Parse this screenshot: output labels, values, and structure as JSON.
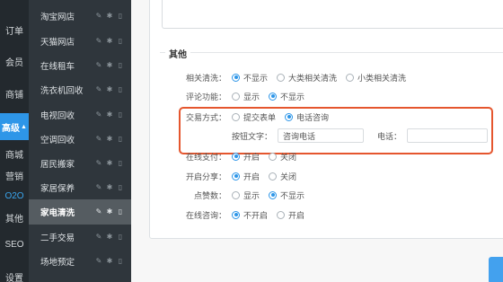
{
  "left_rail": [
    {
      "key": "orders",
      "label": "订单"
    },
    {
      "key": "members",
      "label": "会员"
    },
    {
      "key": "stores",
      "label": "商铺"
    },
    {
      "key": "advanced",
      "label": "高级",
      "active": true
    },
    {
      "key": "mall",
      "label": "商城"
    },
    {
      "key": "marketing",
      "label": "营销"
    },
    {
      "key": "o2o",
      "label": "O2O"
    },
    {
      "key": "other",
      "label": "其他"
    },
    {
      "key": "seo",
      "label": "SEO"
    },
    {
      "key": "settings",
      "label": "设置"
    }
  ],
  "submenu": [
    {
      "label": "淘宝网店"
    },
    {
      "label": "天猫网店"
    },
    {
      "label": "在线租车"
    },
    {
      "label": "洗衣机回收"
    },
    {
      "label": "电视回收"
    },
    {
      "label": "空调回收"
    },
    {
      "label": "居民搬家"
    },
    {
      "label": "家居保养"
    },
    {
      "label": "家电清洗",
      "active": true
    },
    {
      "label": "二手交易"
    },
    {
      "label": "场地预定"
    }
  ],
  "section_title": "其他",
  "settings": {
    "related_clean": {
      "label": "相关清洗：",
      "options": [
        "不显示",
        "大类相关清洗",
        "小类相关清洗"
      ],
      "selected": 0
    },
    "comment": {
      "label": "评论功能：",
      "options": [
        "显示",
        "不显示"
      ],
      "selected": 1
    },
    "trade_mode": {
      "label": "交易方式：",
      "options": [
        "提交表单",
        "电话咨询"
      ],
      "selected": 1
    },
    "button_text": {
      "label": "按钮文字：",
      "value": "咨询电话"
    },
    "phone": {
      "label": "电话：",
      "value": ""
    },
    "online_pay": {
      "label": "在线支付：",
      "options": [
        "开启",
        "关闭"
      ],
      "selected": 0
    },
    "share": {
      "label": "开启分享：",
      "options": [
        "开启",
        "关闭"
      ],
      "selected": 0
    },
    "likes": {
      "label": "点赞数：",
      "options": [
        "显示",
        "不显示"
      ],
      "selected": 1
    },
    "online_consult": {
      "label": "在线咨询：",
      "options": [
        "不开启",
        "开启"
      ],
      "selected": 0
    }
  },
  "colors": {
    "accent": "#2e96e8",
    "highlight": "#e5562e",
    "rail_bg": "#23292e",
    "submenu_bg": "#2f363c"
  }
}
